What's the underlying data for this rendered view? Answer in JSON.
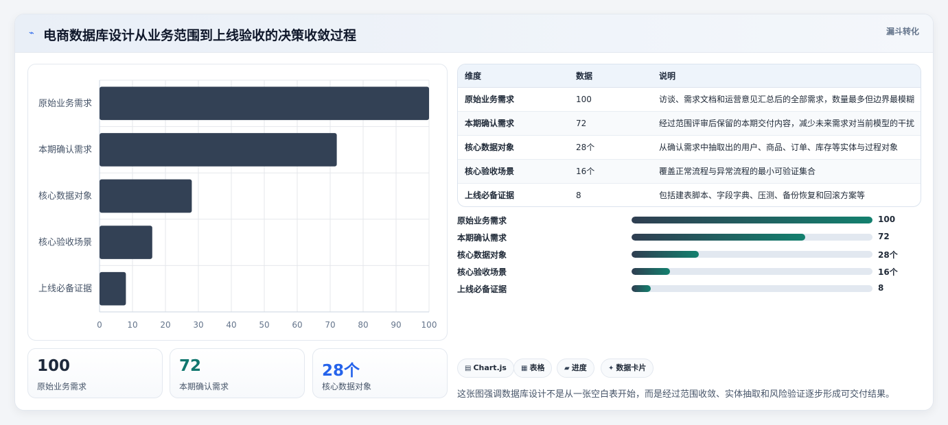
{
  "header": {
    "icon": "lightning-icon",
    "title": "电商数据库设计从业务范围到上线验收的决策收敛过程",
    "tag": "漏斗转化"
  },
  "chart_data": {
    "type": "bar",
    "orientation": "horizontal",
    "categories": [
      "原始业务需求",
      "本期确认需求",
      "核心数据对象",
      "核心验收场景",
      "上线必备证据"
    ],
    "values": [
      100,
      72,
      28,
      16,
      8
    ],
    "xlim": [
      0,
      100
    ],
    "xticks": [
      0,
      10,
      20,
      30,
      40,
      50,
      60,
      70,
      80,
      90,
      100
    ],
    "grid": true,
    "bar_color": "#334155"
  },
  "kpis": [
    {
      "value": "100",
      "label": "原始业务需求",
      "color": "#1e293b"
    },
    {
      "value": "72",
      "label": "本期确认需求",
      "color": "#0f766e"
    },
    {
      "value": "28个",
      "label": "核心数据对象",
      "color": "#2563eb"
    }
  ],
  "table": {
    "headers": [
      "维度",
      "数据",
      "说明"
    ],
    "rows": [
      [
        "原始业务需求",
        "100",
        "访谈、需求文档和运营意见汇总后的全部需求，数量最多但边界最模糊"
      ],
      [
        "本期确认需求",
        "72",
        "经过范围评审后保留的本期交付内容，减少未来需求对当前模型的干扰"
      ],
      [
        "核心数据对象",
        "28个",
        "从确认需求中抽取出的用户、商品、订单、库存等实体与过程对象"
      ],
      [
        "核心验收场景",
        "16个",
        "覆盖正常流程与异常流程的最小可验证集合"
      ],
      [
        "上线必备证据",
        "8",
        "包括建表脚本、字段字典、压测、备份恢复和回滚方案等"
      ]
    ]
  },
  "progress": [
    {
      "label": "原始业务需求",
      "value": 100,
      "display": "100"
    },
    {
      "label": "本期确认需求",
      "value": 72,
      "display": "72"
    },
    {
      "label": "核心数据对象",
      "value": 28,
      "display": "28个"
    },
    {
      "label": "核心验收场景",
      "value": 16,
      "display": "16个"
    },
    {
      "label": "上线必备证据",
      "value": 8,
      "display": "8"
    }
  ],
  "progress_max": 100,
  "chips": [
    {
      "icon": "chart-icon",
      "glyph": "▤",
      "label": "Chart.js"
    },
    {
      "icon": "table-icon",
      "glyph": "▦",
      "label": "表格"
    },
    {
      "icon": "progress-icon",
      "glyph": "▰",
      "label": "进度"
    },
    {
      "icon": "sparkle-icon",
      "glyph": "✦",
      "label": "数据卡片"
    }
  ],
  "caption": "这张图强调数据库设计不是从一张空白表开始，而是经过范围收敛、实体抽取和风险验证逐步形成可交付结果。"
}
